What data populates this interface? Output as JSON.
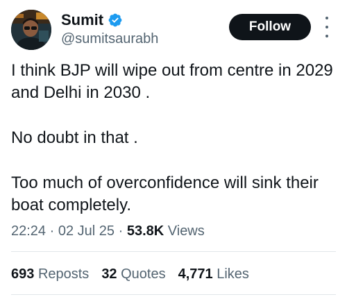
{
  "author": {
    "display_name": "Sumit",
    "handle": "@sumitsaurabh",
    "verified": true,
    "avatar_icon": "profile-photo"
  },
  "header": {
    "follow_label": "Follow",
    "more_icon": "more-options-vertical"
  },
  "tweet": {
    "paragraphs": [
      "I think BJP will wipe out from centre in 2029 and Delhi in 2030 .",
      "No doubt in that .",
      "Too much of overconfidence will sink their boat completely."
    ]
  },
  "meta": {
    "time": "22:24",
    "date": "02 Jul 25",
    "separator": "·",
    "views_count": "53.8K",
    "views_label": "Views"
  },
  "stats": {
    "reposts_count": "693",
    "reposts_label": "Reposts",
    "quotes_count": "32",
    "quotes_label": "Quotes",
    "likes_count": "4,771",
    "likes_label": "Likes"
  },
  "colors": {
    "text_primary": "#0f1419",
    "text_secondary": "#536471",
    "verified_blue": "#1d9bf0",
    "follow_bg": "#0f1419",
    "divider": "#e1e6ea"
  }
}
